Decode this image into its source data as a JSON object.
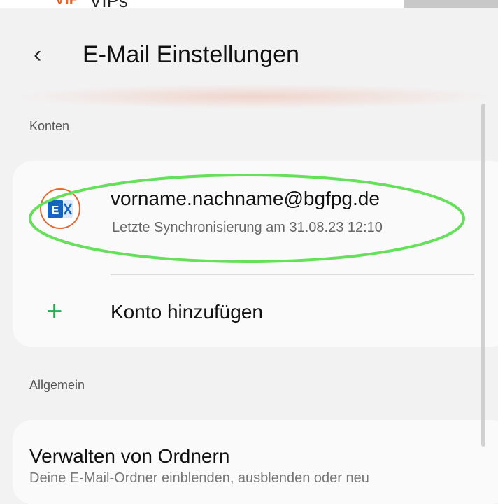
{
  "top_strip": {
    "vip_badge": "VIP",
    "vips_label": "VIPs"
  },
  "header": {
    "back_icon": "chevron-left-icon",
    "title": "E-Mail Einstellungen"
  },
  "sections": {
    "accounts_label": "Konten",
    "general_label": "Allgemein"
  },
  "account": {
    "icon": "exchange-icon",
    "email": "vorname.nachname@bgfpg.de",
    "sync": "Letzte Synchronisierung am 31.08.23 12:10"
  },
  "add_account": {
    "icon": "plus-icon",
    "label": "Konto hinzufügen"
  },
  "folders": {
    "title": "Verwalten von Ordnern",
    "subtitle": "Deine E-Mail-Ordner einblenden, ausblenden oder neu"
  },
  "colors": {
    "accent_green": "#2fa84f",
    "exchange_blue": "#1565c0",
    "annotation_green": "#66e05a",
    "annotation_orange": "#e8662e"
  }
}
